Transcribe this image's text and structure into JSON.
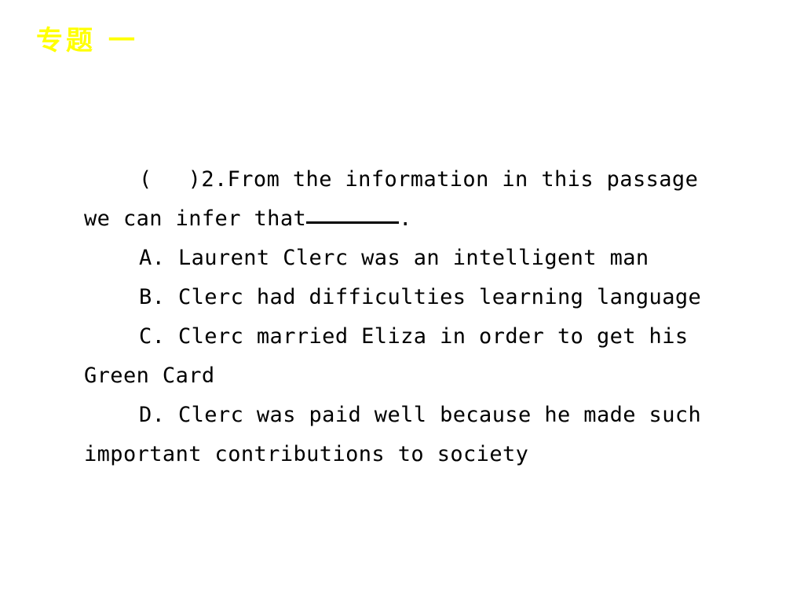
{
  "slide": {
    "background_color": "#ffffff",
    "header": {
      "title": "专题 一",
      "color": "#ffff00"
    },
    "question": {
      "marker_open": "(",
      "marker_close": ")",
      "number": "2.",
      "stem_line_1": "From the information in this passage",
      "stem_line_2_before_blank": "we can infer that",
      "stem_line_2_after_blank": ".",
      "options": [
        {
          "label": "A.",
          "line_1": " Laurent Clerc was an intelligent man",
          "line_2": ""
        },
        {
          "label": "B.",
          "line_1": " Clerc had difficulties learning language",
          "line_2": ""
        },
        {
          "label": "C.",
          "line_1": " Clerc married Eliza in order to get his",
          "line_2": "Green Card"
        },
        {
          "label": "D.",
          "line_1": " Clerc was paid well because he made such",
          "line_2": "important contributions to society"
        }
      ]
    }
  }
}
